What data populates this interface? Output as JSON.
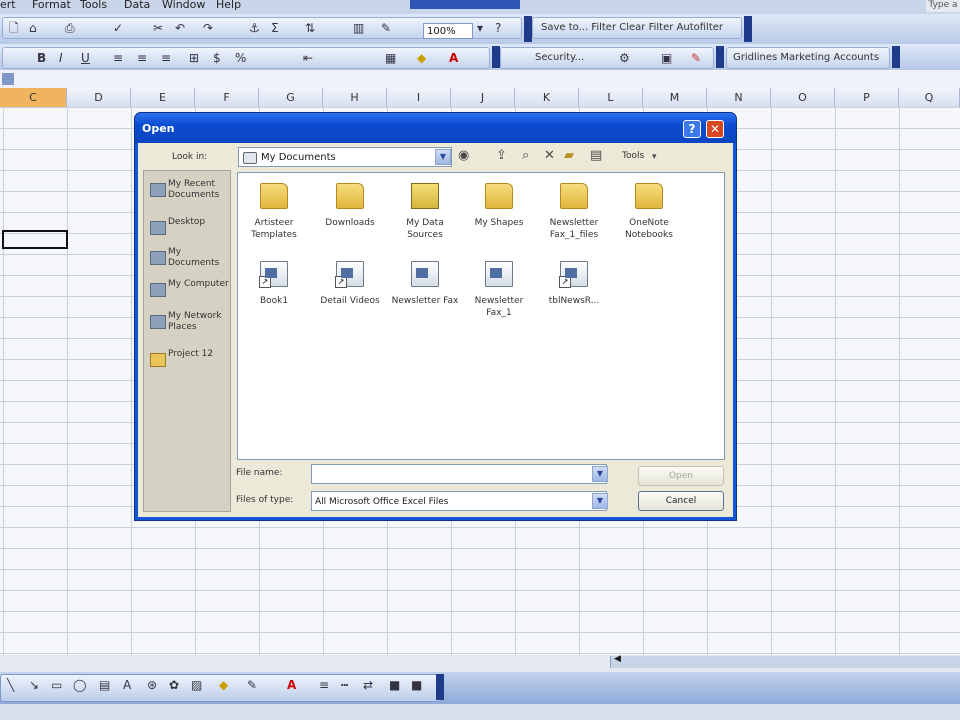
{
  "menu": {
    "items": [
      "ert",
      "Format",
      "Tools",
      "Data",
      "Window",
      "Help"
    ]
  },
  "corner_label": "Type a",
  "toolbar": {
    "zoom_value": "100%",
    "links_label": "Save to... Filter  Clear Filter  Autofilter",
    "security_label": "Security...",
    "addins_label": "Gridlines  Marketing  Accounts"
  },
  "sheet": {
    "columns": [
      "C",
      "D",
      "E",
      "F",
      "G",
      "H",
      "I",
      "J",
      "K",
      "L",
      "M",
      "N",
      "O",
      "P",
      "Q"
    ],
    "selected_column": "C"
  },
  "dialog": {
    "title": "Open",
    "help_glyph": "?",
    "close_glyph": "✕",
    "look_in_label": "Look in:",
    "look_in_value": "My Documents",
    "tools_label": "Tools",
    "places": [
      {
        "label": "My Recent Documents",
        "icon": "recent-documents-icon"
      },
      {
        "label": "Desktop",
        "icon": "desktop-icon"
      },
      {
        "label": "My Documents",
        "icon": "my-documents-icon"
      },
      {
        "label": "My Computer",
        "icon": "my-computer-icon"
      },
      {
        "label": "My Network Places",
        "icon": "network-places-icon"
      },
      {
        "label": "Project 12",
        "icon": "folder-icon"
      }
    ],
    "files": [
      {
        "label": "Artisteer Templates",
        "icon": "folder-icon"
      },
      {
        "label": "Downloads",
        "icon": "folder-icon"
      },
      {
        "label": "My Data Sources",
        "icon": "data-sources-folder-icon"
      },
      {
        "label": "My Shapes",
        "icon": "shapes-folder-icon"
      },
      {
        "label": "Newsletter Fax_1_files",
        "icon": "folder-icon"
      },
      {
        "label": "OneNote Notebooks",
        "icon": "folder-icon"
      },
      {
        "label": "Book1",
        "icon": "excel-shortcut-icon"
      },
      {
        "label": "Detail Videos",
        "icon": "excel-shortcut-icon"
      },
      {
        "label": "Newsletter Fax",
        "icon": "web-page-icon"
      },
      {
        "label": "Newsletter Fax_1",
        "icon": "web-page-icon"
      },
      {
        "label": "tblNewsR...",
        "icon": "excel-shortcut-icon"
      }
    ],
    "file_name_label": "File name:",
    "file_name_value": "",
    "files_of_type_label": "Files of type:",
    "files_of_type_value": "All Microsoft Office Excel Files",
    "open_button": "Open",
    "cancel_button": "Cancel"
  },
  "colors": {
    "title_bar": "#0a4bd0",
    "selected_column": "#f0b35f",
    "dialog_body": "#ece9d8"
  }
}
